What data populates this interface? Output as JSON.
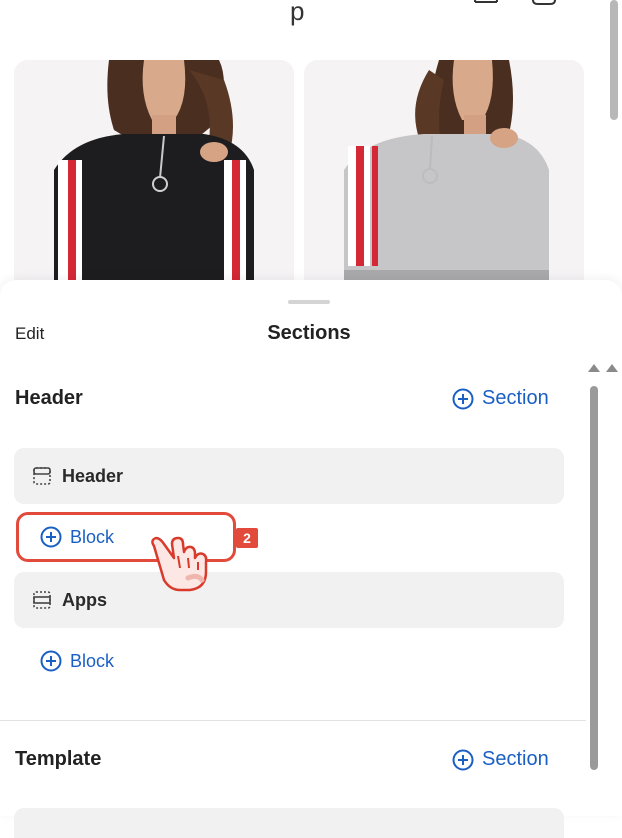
{
  "storefront": {
    "logo_fragment": "p",
    "icons": [
      "account-icon",
      "cart-icon"
    ],
    "products": [
      {
        "color": "black"
      },
      {
        "color": "grey"
      }
    ]
  },
  "sheet": {
    "edit_label": "Edit",
    "title": "Sections",
    "groups": [
      {
        "heading": "Header",
        "add_section_label": "Section",
        "sections": [
          {
            "label": "Header",
            "icon": "header-layout-icon",
            "add_block_label": "Block"
          },
          {
            "label": "Apps",
            "icon": "apps-layout-icon",
            "add_block_label": "Block"
          }
        ]
      },
      {
        "heading": "Template",
        "add_section_label": "Section"
      }
    ]
  },
  "annotation": {
    "step_number": "2",
    "color": "#e24a3b"
  },
  "colors": {
    "accent": "#1a5fc4",
    "row_bg": "#f1f1f1"
  }
}
